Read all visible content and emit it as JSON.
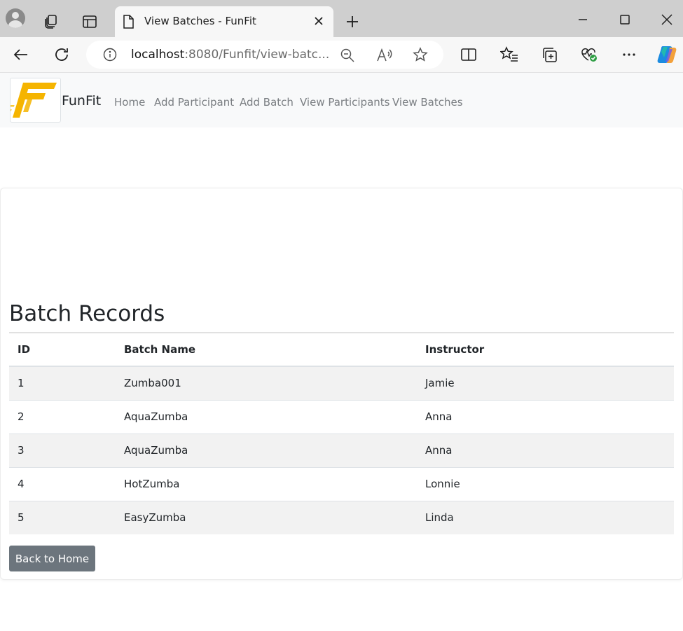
{
  "browser": {
    "tab_title": "View Batches - FunFit",
    "url_host": "localhost",
    "url_rest": ":8080/Funfit/view-batc..."
  },
  "navbar": {
    "brand": "FunFit",
    "logo_letter": "F",
    "links": [
      "Home",
      "Add Participant",
      "Add Batch",
      "View Participants",
      "View Batches"
    ]
  },
  "main": {
    "title": "Batch Records",
    "table": {
      "headers": [
        "ID",
        "Batch Name",
        "Instructor"
      ],
      "rows": [
        [
          "1",
          "Zumba001",
          "Jamie"
        ],
        [
          "2",
          "AquaZumba",
          "Anna"
        ],
        [
          "3",
          "AquaZumba",
          "Anna"
        ],
        [
          "4",
          "HotZumba",
          "Lonnie"
        ],
        [
          "5",
          "EasyZumba",
          "Linda"
        ]
      ]
    },
    "back_button": "Back to Home"
  },
  "colors": {
    "logo": "#f5b400",
    "button": "#6c757d",
    "navbar_bg": "#f8f9fa"
  }
}
